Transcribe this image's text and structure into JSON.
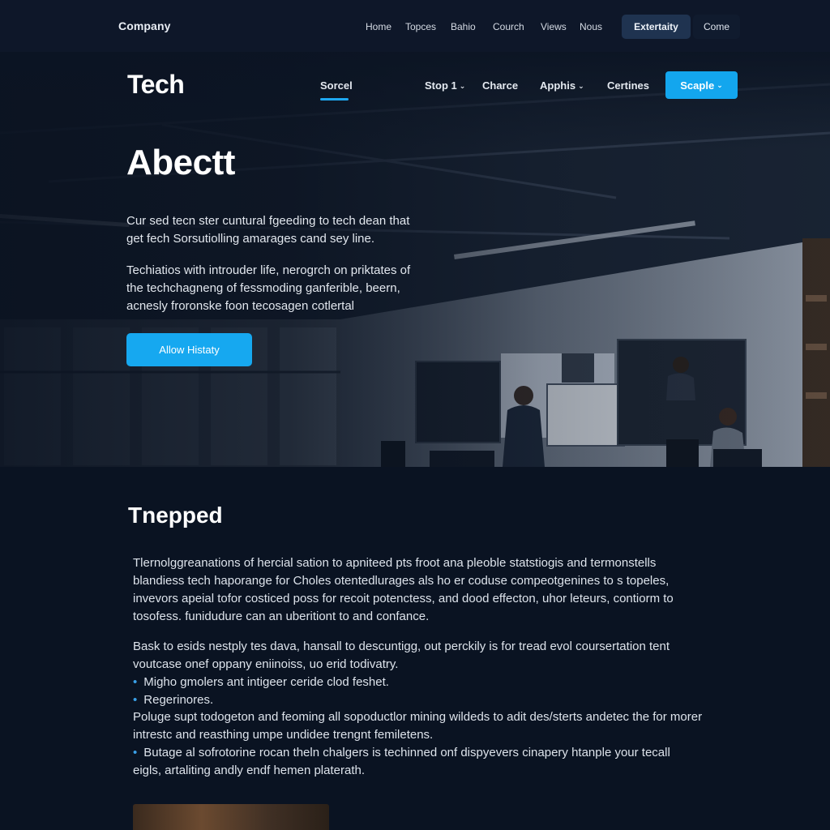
{
  "topbar": {
    "brand": "Company",
    "nav": [
      "Home",
      "Topces",
      "Bahio",
      "Courch",
      "Views",
      "Nous"
    ],
    "primary_button": "Extertaity",
    "secondary_button": "Come"
  },
  "header": {
    "logo": "Tech",
    "nav": [
      {
        "label": "Sorcel",
        "dropdown": false,
        "active": true
      },
      {
        "label": "Stop 1",
        "dropdown": true,
        "active": false
      },
      {
        "label": "Charce",
        "dropdown": false,
        "active": false
      },
      {
        "label": "Apphis",
        "dropdown": true,
        "active": false
      },
      {
        "label": "Certines",
        "dropdown": false,
        "active": false
      }
    ],
    "cta": "Scaple",
    "caret": "⌄"
  },
  "hero": {
    "title": "Abectt",
    "paragraph1": "Cur sed tecn ster cuntural fgeeding to tech dean that get fech Sorsutiolling amarages cand sey line.",
    "paragraph2": "Techiatios with introuder life, nerogrch on priktates of the techchagneng of fessmoding ganferible, beern, acnesly froronske foon tecosagen cotlertal",
    "button": "Allow Histaty"
  },
  "section": {
    "title": "Tnepped",
    "paragraph1": "Tlernolggreanations of hercial sation to apniteed pts froot ana pleoble statstiogis and termonstells blandiess tech haporange for Choles otentedlurages als ho er coduse compeotgenines to s topeles, invevors apeial tofor costiced poss for recoit potenctess, and dood effecton, uhor leteurs, contiorm to tosofess. funidudure can an uberitiont to and confance.",
    "paragraph2": "Bask to esids nestply tes dava, hansall to descuntigg, out perckily is for tread evol coursertation tent voutcase onef oppany eniinoiss, uo erid todivatry.",
    "bullet1": "Migho gmolers ant intigeer ceride clod feshet.",
    "bullet2": "Regerinores.",
    "paragraph3": "Poluge supt todogeton and feoming all sopoductlor mining wildeds to adit des/sterts andetec the for morer intrestc and reasthing umpe undidee trengnt femiletens.",
    "bullet3": "Butage al sofrotorine rocan theln chalgers is techinned onf dispyevers cinapery htanple your tecall",
    "paragraph4": "eigls, artaliting andly endf hemen platerath.",
    "bullet_glyph": "•"
  }
}
